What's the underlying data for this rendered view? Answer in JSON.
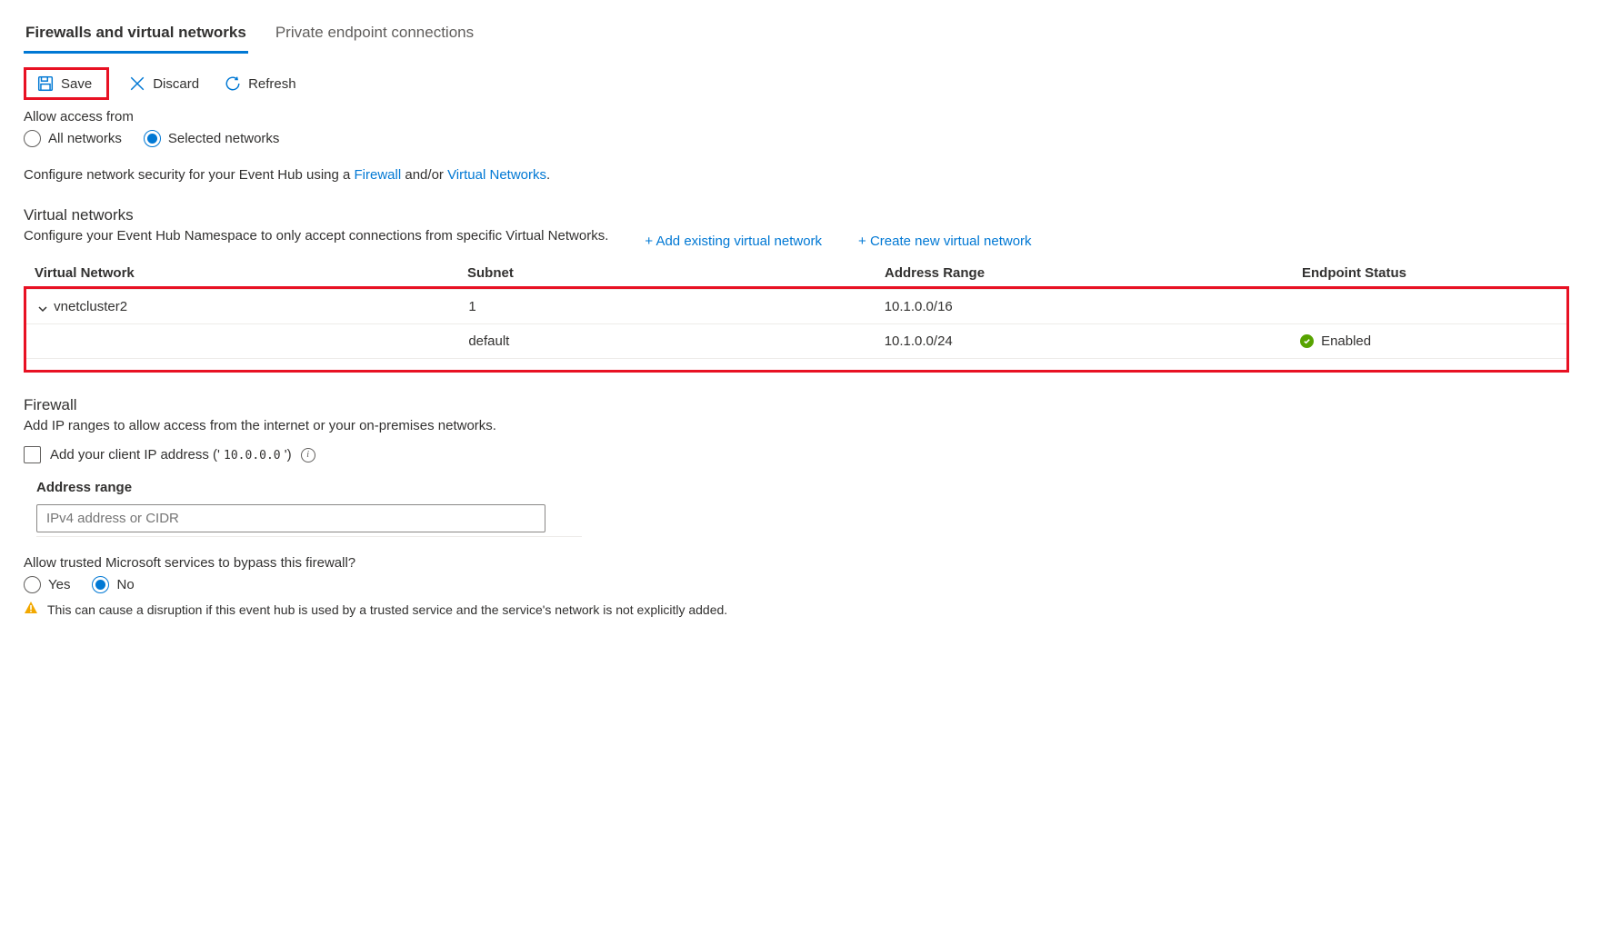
{
  "tabs": [
    {
      "label": "Firewalls and virtual networks",
      "selected": true
    },
    {
      "label": "Private endpoint connections",
      "selected": false
    }
  ],
  "toolbar": {
    "save": "Save",
    "discard": "Discard",
    "refresh": "Refresh"
  },
  "access": {
    "label": "Allow access from",
    "options": [
      {
        "label": "All networks",
        "selected": false
      },
      {
        "label": "Selected networks",
        "selected": true
      }
    ]
  },
  "config_line": {
    "prefix": "Configure network security for your Event Hub using a ",
    "firewall_link": "Firewall",
    "mid": " and/or ",
    "vnet_link": "Virtual Networks",
    "suffix": "."
  },
  "vnet_section": {
    "heading": "Virtual networks",
    "description": "Configure your Event Hub Namespace to only accept connections from specific Virtual Networks.",
    "add_existing": "+ Add existing virtual network",
    "create_new": "+ Create new virtual network",
    "columns": {
      "vnet": "Virtual Network",
      "subnet": "Subnet",
      "range": "Address Range",
      "status": "Endpoint Status"
    },
    "rows": [
      {
        "vnet": "vnetcluster2",
        "subnet": "1",
        "range": "10.1.0.0/16",
        "status": ""
      },
      {
        "vnet": "",
        "subnet": "default",
        "range": "10.1.0.0/24",
        "status": "Enabled"
      }
    ]
  },
  "firewall_section": {
    "heading": "Firewall",
    "description": "Add IP ranges to allow access from the internet or your on-premises networks.",
    "add_client_ip_prefix": "Add your client IP address (' ",
    "client_ip": "10.0.0.0",
    "add_client_ip_suffix": " ')",
    "address_range_label": "Address range",
    "address_range_placeholder": "IPv4 address or CIDR"
  },
  "trusted": {
    "question": "Allow trusted Microsoft services to bypass this firewall?",
    "options": [
      {
        "label": "Yes",
        "selected": false
      },
      {
        "label": "No",
        "selected": true
      }
    ],
    "warning": "This can cause a disruption if this event hub is used by a trusted service and the service's network is not explicitly added."
  },
  "colors": {
    "accent": "#0078d4",
    "highlight": "#e81123",
    "success": "#57a300",
    "warning": "#d18e00"
  }
}
